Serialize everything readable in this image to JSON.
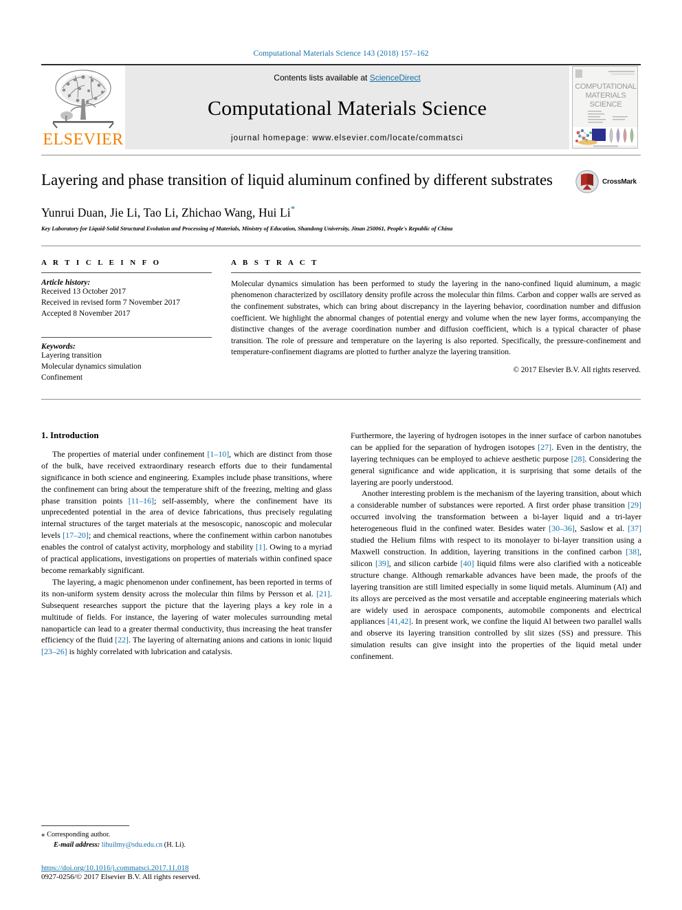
{
  "running_head": "Computational Materials Science 143 (2018) 157–162",
  "banner": {
    "publisher_name": "ELSEVIER",
    "contents_prefix": "Contents lists available at ",
    "contents_link": "ScienceDirect",
    "journal_title": "Computational Materials Science",
    "homepage": "journal homepage: www.elsevier.com/locate/commatsci",
    "cover_title_line1": "COMPUTATIONAL",
    "cover_title_line2": "MATERIALS",
    "cover_title_line3": "SCIENCE"
  },
  "article": {
    "title": "Layering and phase transition of liquid aluminum confined by different substrates",
    "crossmark_label": "CrossMark",
    "authors": "Yunrui Duan, Jie Li, Tao Li, Zhichao Wang, Hui Li",
    "author_star": "*",
    "affiliation": "Key Laboratory for Liquid-Solid Structural Evolution and Processing of Materials, Ministry of Education, Shandong University, Jinan 250061, People's Republic of China"
  },
  "article_info": {
    "heading": "A R T I C L E   I N F O",
    "history_label": "Article history:",
    "history": [
      "Received 13 October 2017",
      "Received in revised form 7 November 2017",
      "Accepted 8 November 2017"
    ],
    "keywords_label": "Keywords:",
    "keywords": [
      "Layering transition",
      "Molecular dynamics simulation",
      "Confinement"
    ]
  },
  "abstract": {
    "heading": "A B S T R A C T",
    "text": "Molecular dynamics simulation has been performed to study the layering in the nano-confined liquid aluminum, a magic phenomenon characterized by oscillatory density profile across the molecular thin films. Carbon and copper walls are served as the confinement substrates, which can bring about discrepancy in the layering behavior, coordination number and diffusion coefficient. We highlight the abnormal changes of potential energy and volume when the new layer forms, accompanying the distinctive changes of the average coordination number and diffusion coefficient, which is a typical character of phase transition. The role of pressure and temperature on the layering is also reported. Specifically, the pressure-confinement and temperature-confinement diagrams are plotted to further analyze the layering transition.",
    "copyright": "© 2017 Elsevier B.V. All rights reserved."
  },
  "introduction": {
    "section_title": "1. Introduction",
    "left_paragraphs": [
      "The properties of material under confinement [1–10], which are distinct from those of the bulk, have received extraordinary research efforts due to their fundamental significance in both science and engineering. Examples include phase transitions, where the confinement can bring about the temperature shift of the freezing, melting and glass phase transition points [11–16]; self-assembly, where the confinement have its unprecedented potential in the area of device fabrications, thus precisely regulating internal structures of the target materials at the mesoscopic, nanoscopic and molecular levels [17–20]; and chemical reactions, where the confinement within carbon nanotubes enables the control of catalyst activity, morphology and stability [1]. Owing to a myriad of practical applications, investigations on properties of materials within confined space become remarkably significant.",
      "The layering, a magic phenomenon under confinement, has been reported in terms of its non-uniform system density across the molecular thin films by Persson et al. [21]. Subsequent researches support the picture that the layering plays a key role in a multitude of fields. For instance, the layering of water molecules surrounding metal nanoparticle can lead to a greater thermal conductivity, thus increasing the heat transfer efficiency of the fluid [22]. The layering of alternating anions and cations in ionic liquid [23–26] is highly correlated with lubrication and catalysis."
    ],
    "right_paragraphs": [
      "Furthermore, the layering of hydrogen isotopes in the inner surface of carbon nanotubes can be applied for the separation of hydrogen isotopes [27]. Even in the dentistry, the layering techniques can be employed to achieve aesthetic purpose [28]. Considering the general significance and wide application, it is surprising that some details of the layering are poorly understood.",
      "Another interesting problem is the mechanism of the layering transition, about which a considerable number of substances were reported. A first order phase transition [29] occurred involving the transformation between a bi-layer liquid and a tri-layer heterogeneous fluid in the confined water. Besides water [30–36], Saslow et al. [37] studied the Helium films with respect to its monolayer to bi-layer transition using a Maxwell construction. In addition, layering transitions in the confined carbon [38], silicon [39], and silicon carbide [40] liquid films were also clarified with a noticeable structure change. Although remarkable advances have been made, the proofs of the layering transition are still limited especially in some liquid metals. Aluminum (Al) and its alloys are perceived as the most versatile and acceptable engineering materials which are widely used in aerospace components, automobile components and electrical appliances [41,42]. In present work, we confine the liquid Al between two parallel walls and observe its layering transition controlled by slit sizes (SS) and pressure. This simulation results can give insight into the properties of the liquid metal under confinement."
    ]
  },
  "footnote": {
    "corresponding_star": "⁎",
    "corresponding_text": "Corresponding author.",
    "email_label": "E-mail address:",
    "email": "lihuilmy@sdu.edu.cn",
    "email_suffix": "(H. Li).",
    "doi": "https://doi.org/10.1016/j.commatsci.2017.11.018",
    "issn_copyright": "0927-0256/© 2017 Elsevier B.V. All rights reserved."
  },
  "colors": {
    "link_blue": "#1270a8",
    "elsevier_orange": "#f08000",
    "banner_gray": "#e9e9e9"
  }
}
